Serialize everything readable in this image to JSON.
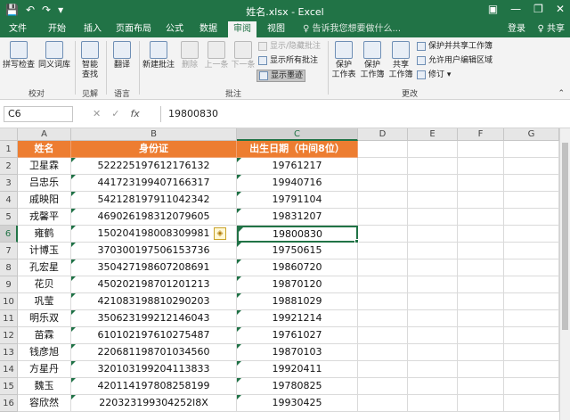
{
  "window": {
    "title": "姓名.xlsx - Excel",
    "qat": {
      "save": "💾",
      "undo": "↶",
      "redo": "↷",
      "customize": "▾"
    },
    "controls": {
      "options": "▣",
      "minimize": "—",
      "restore": "❐",
      "close": "✕"
    }
  },
  "tabs": [
    {
      "label": "文件"
    },
    {
      "label": "开始"
    },
    {
      "label": "插入"
    },
    {
      "label": "页面布局"
    },
    {
      "label": "公式"
    },
    {
      "label": "数据"
    },
    {
      "label": "审阅"
    },
    {
      "label": "视图"
    }
  ],
  "search_tell": "♀ 告诉我您想要做什么...",
  "account": {
    "login": "登录",
    "share": "♀ 共享"
  },
  "ribbon": {
    "groups": {
      "proofing": "校对",
      "insights": "见解",
      "language": "语言",
      "comments": "批注",
      "changes": "更改"
    },
    "buttons": {
      "spell": "拼写检查",
      "thesaurus": "同义词库",
      "smart_lookup_1": "智能",
      "smart_lookup_2": "查找",
      "translate": "翻译",
      "new_comment": "新建批注",
      "delete": "删除",
      "prev": "上一条",
      "next": "下一条",
      "show_hide_comment": "显示/隐藏批注",
      "show_all_comments": "显示所有批注",
      "show_ink": "显示墨迹",
      "protect_sheet_1": "保护",
      "protect_sheet_2": "工作表",
      "protect_wb_1": "保护",
      "protect_wb_2": "工作簿",
      "share_wb_1": "共享",
      "share_wb_2": "工作簿",
      "protect_share": "保护并共享工作簿",
      "allow_edit": "允许用户编辑区域",
      "track_changes": "修订 ▾"
    }
  },
  "formula_bar": {
    "name_box": "C6",
    "cancel": "✕",
    "enter": "✓",
    "fx": "fx",
    "value": "19800830"
  },
  "columns": [
    "A",
    "B",
    "C",
    "D",
    "E",
    "F",
    "G"
  ],
  "rows": [
    "1",
    "2",
    "3",
    "4",
    "5",
    "6",
    "7",
    "8",
    "9",
    "10",
    "11",
    "12",
    "13",
    "14",
    "15",
    "16"
  ],
  "table": {
    "header": {
      "name": "姓名",
      "id": "身份证",
      "birth": "出生日期（中间8位）"
    },
    "data": [
      {
        "name": "卫星霖",
        "id": "522225197612176132",
        "birth": "19761217"
      },
      {
        "name": "吕忠乐",
        "id": "441723199407166317",
        "birth": "19940716"
      },
      {
        "name": "戚映阳",
        "id": "542128197911042342",
        "birth": "19791104"
      },
      {
        "name": "戎馨平",
        "id": "469026198312079605",
        "birth": "19831207"
      },
      {
        "name": "雍鹤",
        "id": "150204198008309981",
        "birth": "19800830"
      },
      {
        "name": "计博玉",
        "id": "370300197506153736",
        "birth": "19750615"
      },
      {
        "name": "孔宏星",
        "id": "350427198607208691",
        "birth": "19860720"
      },
      {
        "name": "花贝",
        "id": "450202198701201213",
        "birth": "19870120"
      },
      {
        "name": "巩莹",
        "id": "421083198810290203",
        "birth": "19881029"
      },
      {
        "name": "明乐双",
        "id": "350623199212146043",
        "birth": "19921214"
      },
      {
        "name": "苗霖",
        "id": "610102197610275487",
        "birth": "19761027"
      },
      {
        "name": "钱彦旭",
        "id": "220681198701034560",
        "birth": "19870103"
      },
      {
        "name": "方星丹",
        "id": "320103199204113833",
        "birth": "19920411"
      },
      {
        "name": "魏玉",
        "id": "420114197808258199",
        "birth": "19780825"
      },
      {
        "name": "容欣然",
        "id": "220323199304252l8X",
        "birth": "19930425"
      }
    ]
  },
  "warning_icon": "◈"
}
